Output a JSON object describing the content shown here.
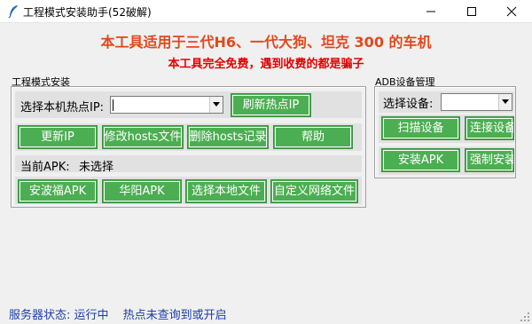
{
  "window": {
    "title": "工程模式安装助手(52破解)",
    "controls": {
      "minimize": "minimize-icon",
      "maximize": "maximize-icon",
      "close": "close-icon"
    }
  },
  "headings": {
    "line1": "本工具适用于三代H6、一代大狗、坦克 300 的车机",
    "line2": "本工具完全免费，遇到收费的都是骗子"
  },
  "engineering": {
    "group_label": "工程模式安装",
    "hotspot_label": "选择本机热点IP:",
    "hotspot_value": "",
    "refresh_button": "刷新热点IP",
    "buttons": [
      "更新IP",
      "修改hosts文件",
      "删除hosts记录",
      "帮助"
    ],
    "apk_label": "当前APK:",
    "apk_value": "未选择",
    "apk_buttons": [
      "安波福APK",
      "华阳APK",
      "选择本地文件",
      "自定义网络文件"
    ]
  },
  "adb": {
    "group_label": "ADB设备管理",
    "device_label": "选择设备:",
    "device_value": "",
    "buttons": [
      "扫描设备",
      "连接设备",
      "安装APK",
      "强制安装"
    ]
  },
  "status": {
    "server": "服务器状态: 运行中",
    "hotspot": "热点未查询到或开启"
  },
  "colors": {
    "button_green": "#4cae52",
    "heading_orange": "#e0491b",
    "heading_red": "#e00000",
    "status_blue": "#1c3ca8"
  }
}
